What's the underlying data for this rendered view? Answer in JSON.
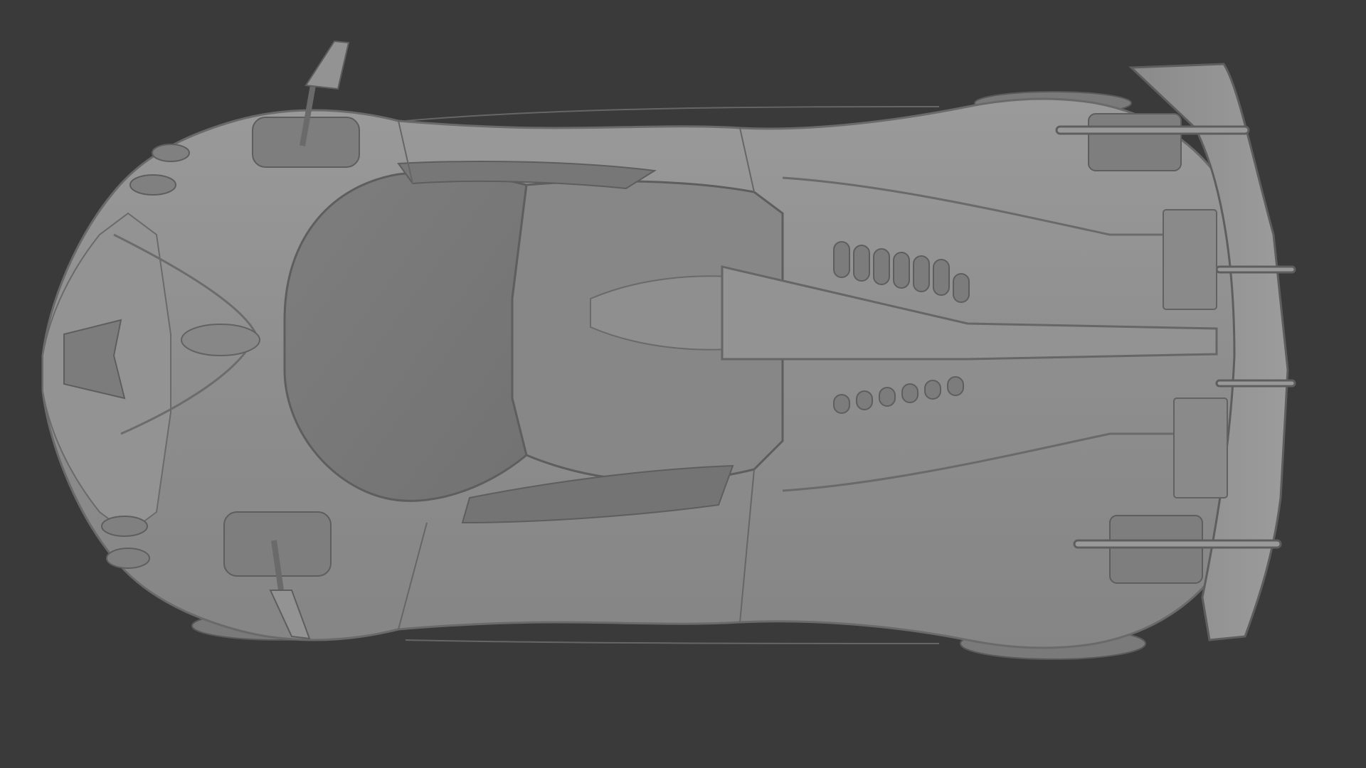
{
  "scene": {
    "background_color": "#3a3a3a",
    "subject": "car-model-top-view",
    "model_base_color": "#8c8c8c",
    "model_shadow_color": "#6e6e6e",
    "model_highlight_color": "#a4a4a4",
    "glass_color": "#7a7a7a",
    "line_color": "#5e5e5e"
  }
}
